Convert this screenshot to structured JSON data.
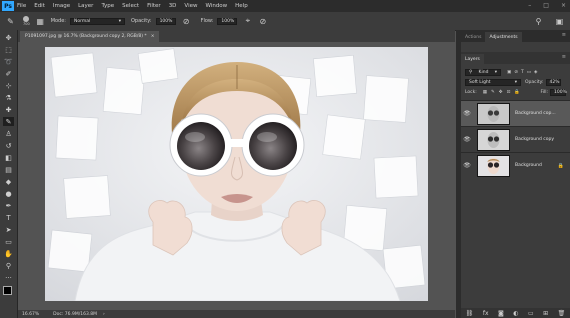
{
  "menu": {
    "logo": "Ps",
    "items": [
      "File",
      "Edit",
      "Image",
      "Layer",
      "Type",
      "Select",
      "Filter",
      "3D",
      "View",
      "Window",
      "Help"
    ]
  },
  "options": {
    "brush_size": "700",
    "mode_label": "Mode:",
    "mode_value": "Normal",
    "opacity_label": "Opacity:",
    "opacity_value": "100%",
    "flow_label": "Flow:",
    "flow_value": "100%"
  },
  "document": {
    "tab_title": "P1091097.jpg @ 16.7% (Background copy 2, RGB/8) *",
    "close": "×"
  },
  "status": {
    "zoom": "16.67%",
    "doc_size": "Doc: 76.9M/163.8M"
  },
  "panels": {
    "top_tabs": [
      "Actions",
      "Adjustments"
    ],
    "layers_tab": "Layers",
    "kind": "Kind",
    "blend_mode": "Soft Light",
    "opacity_label": "Opacity:",
    "opacity_value": "42%",
    "lock_label": "Lock:",
    "fill_label": "Fill:",
    "fill_value": "100%",
    "layers": [
      {
        "name": "Background cop...",
        "selected": true
      },
      {
        "name": "Background copy",
        "selected": false
      },
      {
        "name": "Background",
        "selected": false
      }
    ]
  }
}
